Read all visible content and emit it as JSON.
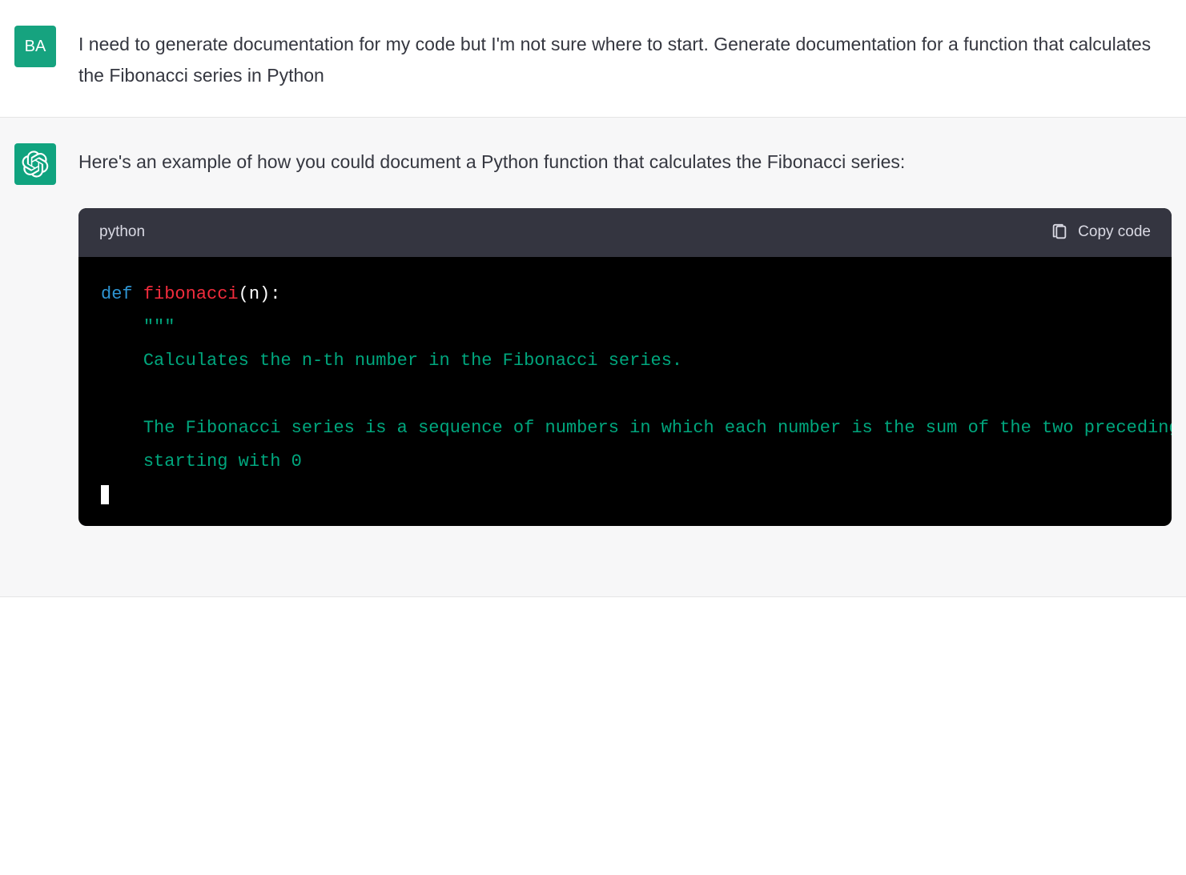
{
  "user": {
    "avatar_initials": "BA",
    "message": "I need to generate documentation for my code but I'm not sure where to start. Generate documentation for a function that calculates the Fibonacci series in Python"
  },
  "assistant": {
    "intro_text": "Here's an example of how you could document a Python function that calculates the Fibonacci series:",
    "code_block": {
      "language": "python",
      "copy_label": "Copy code",
      "tokens": {
        "kw_def": "def",
        "func_name": "fibonacci",
        "open_paren": "(",
        "param": "n",
        "close_paren_colon": "):",
        "doc_open": "\"\"\"",
        "doc_line1": "Calculates the n-th number in the Fibonacci series.",
        "doc_line2": "The Fibonacci series is a sequence of numbers in which each number is the sum of the two preceding ones,",
        "doc_line3": "starting with 0"
      }
    }
  }
}
